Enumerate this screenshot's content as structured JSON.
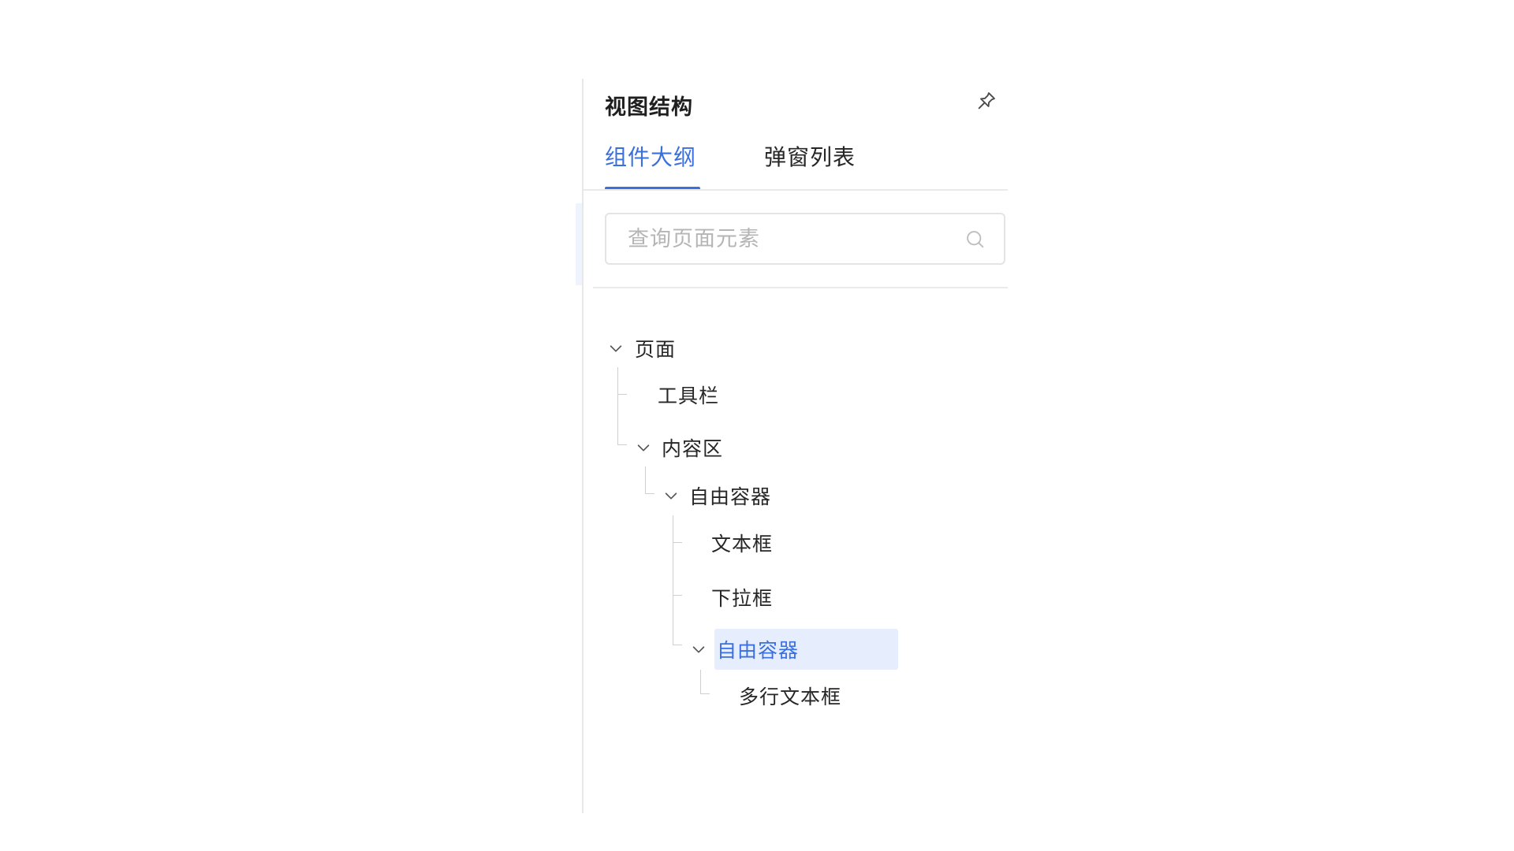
{
  "panel": {
    "title": "视图结构",
    "pin_icon": "pin-icon"
  },
  "tabs": [
    {
      "label": "组件大纲",
      "active": true
    },
    {
      "label": "弹窗列表",
      "active": false
    }
  ],
  "search": {
    "placeholder": "查询页面元素",
    "value": "",
    "icon": "search-icon"
  },
  "tree": {
    "nodes": [
      {
        "label": "页面",
        "expanded": true,
        "depth": 0
      },
      {
        "label": "工具栏",
        "depth": 1
      },
      {
        "label": "内容区",
        "expanded": true,
        "depth": 1
      },
      {
        "label": "自由容器",
        "expanded": true,
        "depth": 2
      },
      {
        "label": "文本框",
        "depth": 3
      },
      {
        "label": "下拉框",
        "depth": 3
      },
      {
        "label": "自由容器",
        "expanded": true,
        "selected": true,
        "depth": 3
      },
      {
        "label": "多行文本框",
        "depth": 4
      }
    ]
  },
  "colors": {
    "accent": "#3a6fe0",
    "selected_bg": "#e6eefd",
    "border": "#e4e4e4",
    "text": "#262626",
    "placeholder": "#b5b5b5"
  }
}
